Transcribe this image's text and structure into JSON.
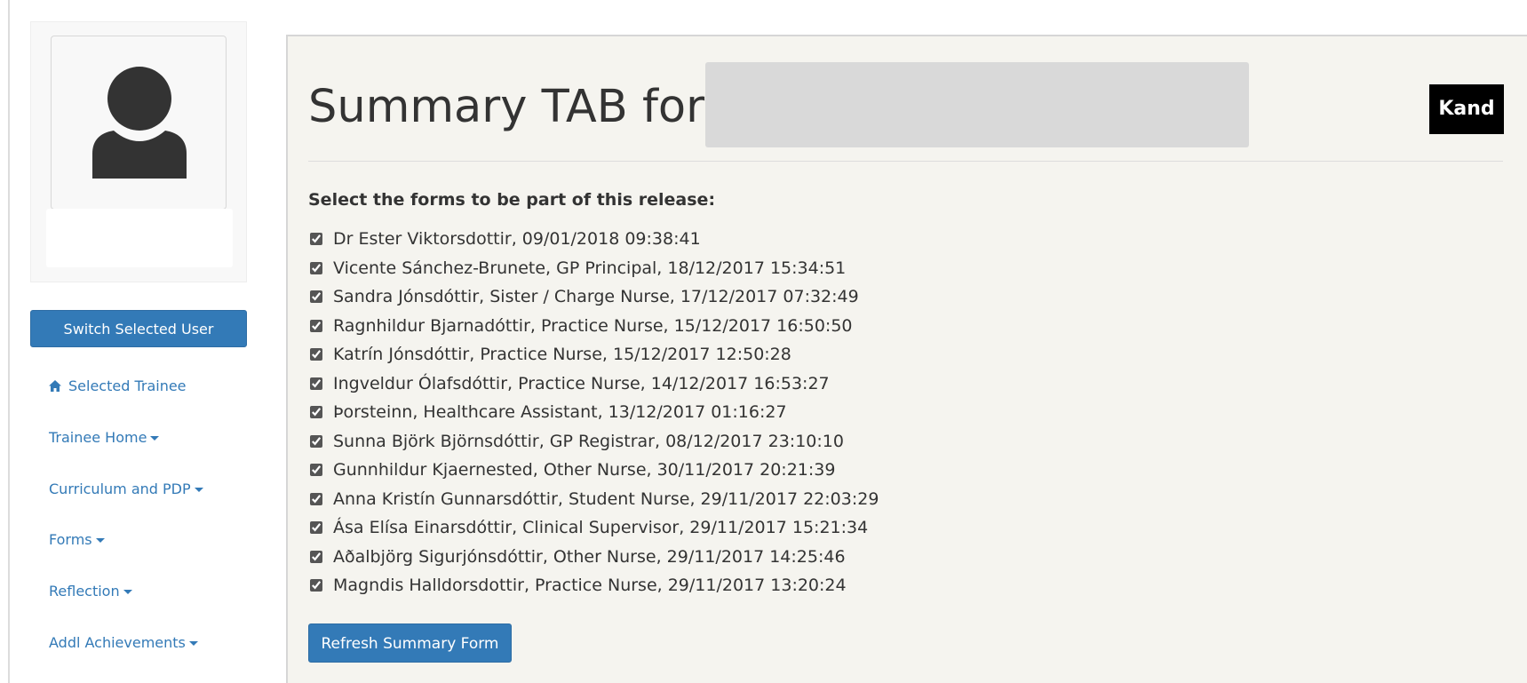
{
  "sidebar": {
    "switch_user_label": "Switch Selected User",
    "nav": [
      {
        "label": "Selected Trainee",
        "icon": "home-icon"
      },
      {
        "label": "Trainee Home",
        "icon": "caret-down-icon"
      },
      {
        "label": "Curriculum and PDP",
        "icon": "caret-down-icon"
      },
      {
        "label": "Forms",
        "icon": "caret-down-icon"
      },
      {
        "label": "Reflection",
        "icon": "caret-down-icon"
      },
      {
        "label": "Addl Achievements",
        "icon": "caret-down-icon"
      }
    ]
  },
  "main": {
    "title": "Summary TAB for",
    "badge": "Kand",
    "select_label": "Select the forms to be part of this release:",
    "forms": [
      {
        "label": "Dr Ester Viktorsdottir, 09/01/2018 09:38:41",
        "checked": true
      },
      {
        "label": "Vicente Sánchez-Brunete, GP Principal, 18/12/2017 15:34:51",
        "checked": true
      },
      {
        "label": "Sandra Jónsdóttir, Sister / Charge Nurse, 17/12/2017 07:32:49",
        "checked": true
      },
      {
        "label": "Ragnhildur Bjarnadóttir, Practice Nurse, 15/12/2017 16:50:50",
        "checked": true
      },
      {
        "label": "Katrín Jónsdóttir, Practice Nurse, 15/12/2017 12:50:28",
        "checked": true
      },
      {
        "label": "Ingveldur Ólafsdóttir, Practice Nurse, 14/12/2017 16:53:27",
        "checked": true
      },
      {
        "label": "Þorsteinn, Healthcare Assistant, 13/12/2017 01:16:27",
        "checked": true
      },
      {
        "label": "Sunna Björk Björnsdóttir, GP Registrar, 08/12/2017 23:10:10",
        "checked": true
      },
      {
        "label": "Gunnhildur Kjaernested, Other Nurse, 30/11/2017 20:21:39",
        "checked": true
      },
      {
        "label": "Anna Kristín Gunnarsdóttir, Student Nurse, 29/11/2017 22:03:29",
        "checked": true
      },
      {
        "label": "Ása Elísa Einarsdóttir, Clinical Supervisor, 29/11/2017 15:21:34",
        "checked": true
      },
      {
        "label": "Aðalbjörg Sigurjónsdóttir, Other Nurse, 29/11/2017 14:25:46",
        "checked": true
      },
      {
        "label": "Magndis Halldorsdottir, Practice Nurse, 29/11/2017 13:20:24",
        "checked": true
      }
    ],
    "refresh_label": "Refresh Summary Form"
  },
  "colors": {
    "primary": "#337ab7",
    "panel_bg": "#f5f4ef",
    "badge_bg": "#000000"
  }
}
